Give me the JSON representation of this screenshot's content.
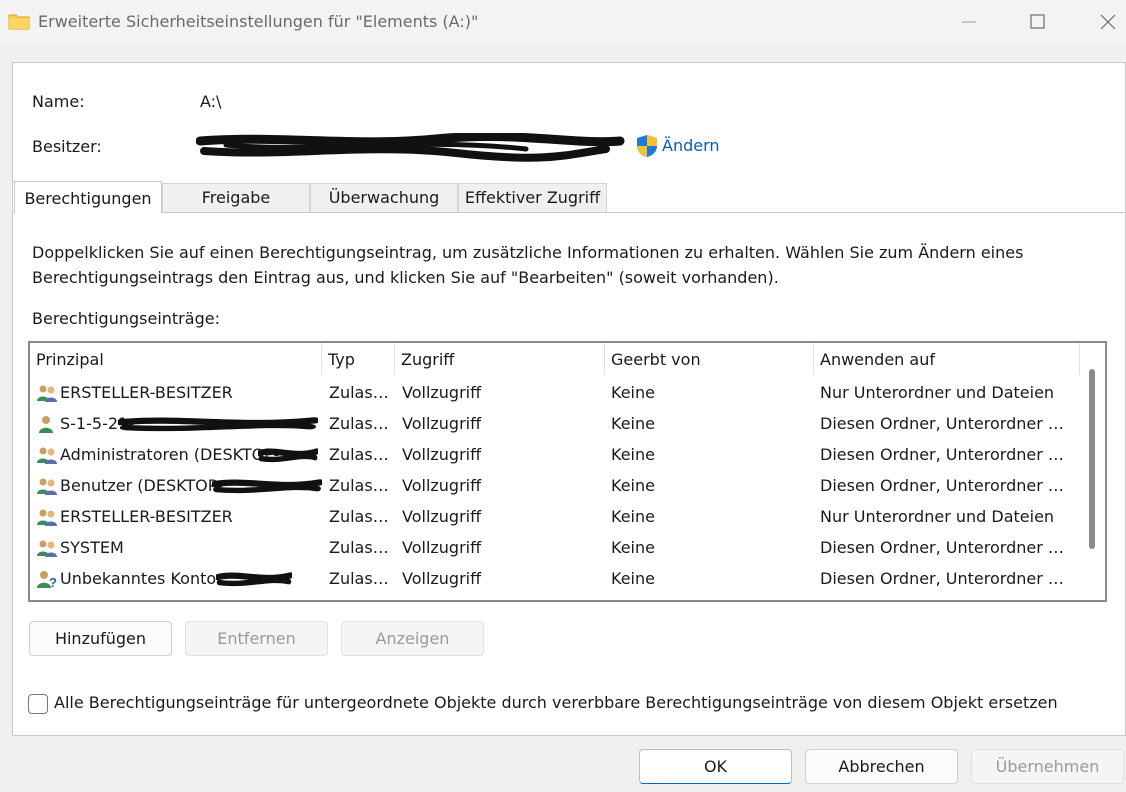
{
  "window": {
    "title": "Erweiterte Sicherheitseinstellungen für \"Elements (A:)\""
  },
  "info": {
    "name_label": "Name:",
    "name_value": "A:\\",
    "owner_label": "Besitzer:",
    "change_link": "Ändern"
  },
  "tabs": [
    {
      "label": "Berechtigungen",
      "active": true
    },
    {
      "label": "Freigabe",
      "active": false
    },
    {
      "label": "Überwachung",
      "active": false
    },
    {
      "label": "Effektiver Zugriff",
      "active": false
    }
  ],
  "description": "Doppelklicken Sie auf einen Berechtigungseintrag, um zusätzliche Informationen zu erhalten. Wählen Sie zum Ändern eines Berechtigungseintrags den Eintrag aus, und klicken Sie auf \"Bearbeiten\" (soweit vorhanden).",
  "entries_label": "Berechtigungseinträge:",
  "columns": [
    "Prinzipal",
    "Typ",
    "Zugriff",
    "Geerbt von",
    "Anwenden auf"
  ],
  "rows": [
    {
      "principal": "ERSTELLER-BESITZER",
      "type": "Zulass...",
      "access": "Vollzugriff",
      "inherited": "Keine",
      "applies": "Nur Unterordner und Dateien",
      "icon": "group-users-icon"
    },
    {
      "principal": "S-1-5-21-",
      "type": "Zulass...",
      "access": "Vollzugriff",
      "inherited": "Keine",
      "applies": "Diesen Ordner, Unterordner u...",
      "icon": "user-icon"
    },
    {
      "principal": "Administratoren (DESKTOP-",
      "type": "Zulass...",
      "access": "Vollzugriff",
      "inherited": "Keine",
      "applies": "Diesen Ordner, Unterordner u...",
      "icon": "group-users-icon"
    },
    {
      "principal": "Benutzer (DESKTOP-",
      "type": "Zulass...",
      "access": "Vollzugriff",
      "inherited": "Keine",
      "applies": "Diesen Ordner, Unterordner u...",
      "icon": "group-users-icon"
    },
    {
      "principal": "ERSTELLER-BESITZER",
      "type": "Zulass...",
      "access": "Vollzugriff",
      "inherited": "Keine",
      "applies": "Nur Unterordner und Dateien",
      "icon": "group-users-icon"
    },
    {
      "principal": "SYSTEM",
      "type": "Zulass...",
      "access": "Vollzugriff",
      "inherited": "Keine",
      "applies": "Diesen Ordner, Unterordner u...",
      "icon": "group-users-icon"
    },
    {
      "principal": "Unbekanntes Konto",
      "type": "Zulass...",
      "access": "Vollzugriff",
      "inherited": "Keine",
      "applies": "Diesen Ordner, Unterordner u...",
      "icon": "unknown-user-icon"
    }
  ],
  "buttons": {
    "add": "Hinzufügen",
    "remove": "Entfernen",
    "view": "Anzeigen",
    "ok": "OK",
    "cancel": "Abbrechen",
    "apply": "Übernehmen"
  },
  "checkbox_label": "Alle Berechtigungseinträge für untergeordnete Objekte durch vererbbare Berechtigungseinträge von diesem Objekt ersetzen",
  "colors": {
    "link": "#0b5cad",
    "accent": "#0067c0"
  }
}
